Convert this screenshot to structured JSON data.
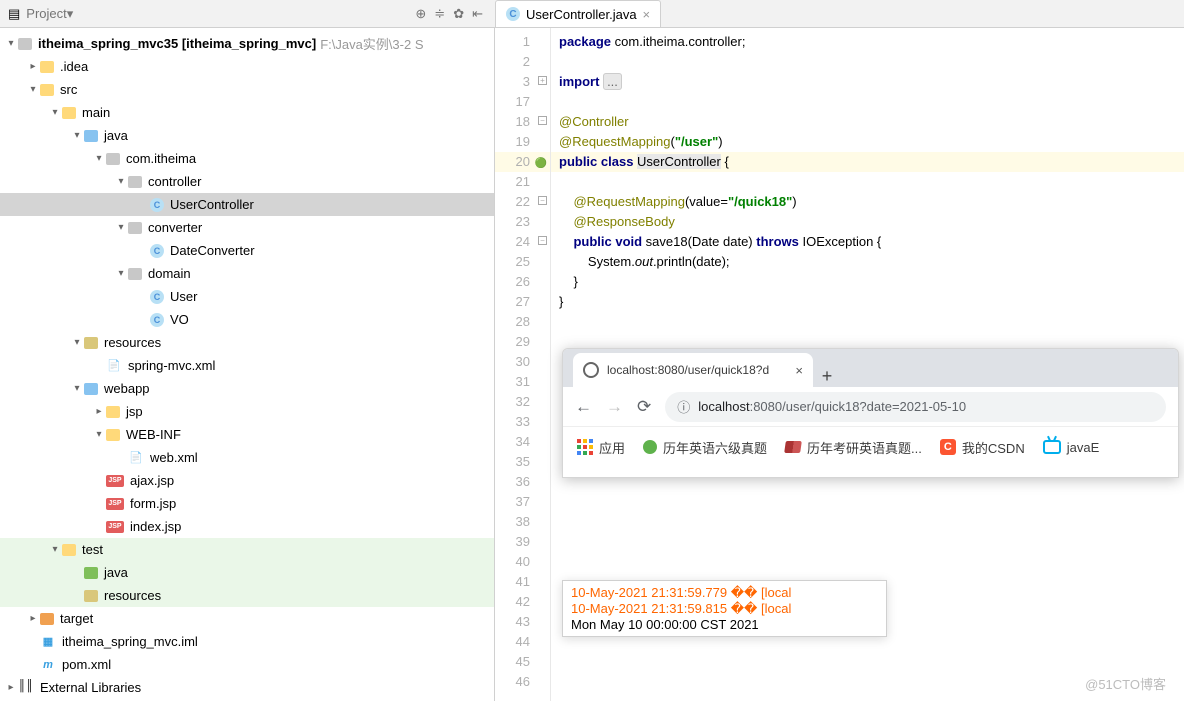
{
  "toolbar": {
    "title": "Project"
  },
  "tab": {
    "filename": "UserController.java"
  },
  "tree": {
    "root_name": "itheima_spring_mvc35",
    "root_context": "[itheima_spring_mvc]",
    "root_path": "F:\\Java实例\\3-2 S",
    "idea": ".idea",
    "src": "src",
    "main": "main",
    "java": "java",
    "pkg": "com.itheima",
    "controller": "controller",
    "usercontroller": "UserController",
    "converter": "converter",
    "dateconverter": "DateConverter",
    "domain": "domain",
    "user": "User",
    "vo": "VO",
    "resources": "resources",
    "springmvcxml": "spring-mvc.xml",
    "webapp": "webapp",
    "jsp": "jsp",
    "webinf": "WEB-INF",
    "webxml": "web.xml",
    "ajaxjsp": "ajax.jsp",
    "formjsp": "form.jsp",
    "indexjsp": "index.jsp",
    "test": "test",
    "testjava": "java",
    "testres": "resources",
    "target": "target",
    "iml": "itheima_spring_mvc.iml",
    "pom": "pom.xml",
    "extlib": "External Libraries"
  },
  "gutter": [
    "1",
    "2",
    "3",
    "17",
    "18",
    "19",
    "20",
    "21",
    "22",
    "23",
    "24",
    "25",
    "26",
    "27",
    "28",
    "29",
    "30",
    "31",
    "32",
    "33",
    "34",
    "35",
    "36",
    "37",
    "38",
    "39",
    "40",
    "41",
    "42",
    "43",
    "44",
    "45",
    "46"
  ],
  "code": {
    "l1_kw1": "package",
    "l1_rest": " com.itheima.controller;",
    "l3_kw": "import ",
    "l18": "@Controller",
    "l19a": "@RequestMapping",
    "l19b": "(",
    "l19s": "\"/user\"",
    "l19c": ")",
    "l20_kw": "public class ",
    "l20_name": "UserController",
    "l20_end": " {",
    "l22a": "    @RequestMapping",
    "l22b": "(value=",
    "l22s": "\"/quick18\"",
    "l22c": ")",
    "l23": "    @ResponseBody",
    "l24a": "    public void ",
    "l24b": "save18(Date date) ",
    "l24c": "throws ",
    "l24d": "IOException {",
    "l25a": "        System.",
    "l25b": "out",
    "l25c": ".println(date);",
    "l26": "    }",
    "l27": "}"
  },
  "browser": {
    "tab_title": "localhost:8080/user/quick18?d",
    "url_host": "localhost",
    "url_path": ":8080/user/quick18?date=2021-05-10",
    "bm_apps": "应用",
    "bm1": "历年英语六级真题",
    "bm2": "历年考研英语真题...",
    "bm3": "我的CSDN",
    "bm4": "javaE"
  },
  "console": {
    "l1": "10-May-2021 21:31:59.779 �� [local",
    "l2": "10-May-2021 21:31:59.815 �� [local",
    "l3": "Mon May 10 00:00:00 CST 2021"
  },
  "watermark": "@51CTO博客"
}
